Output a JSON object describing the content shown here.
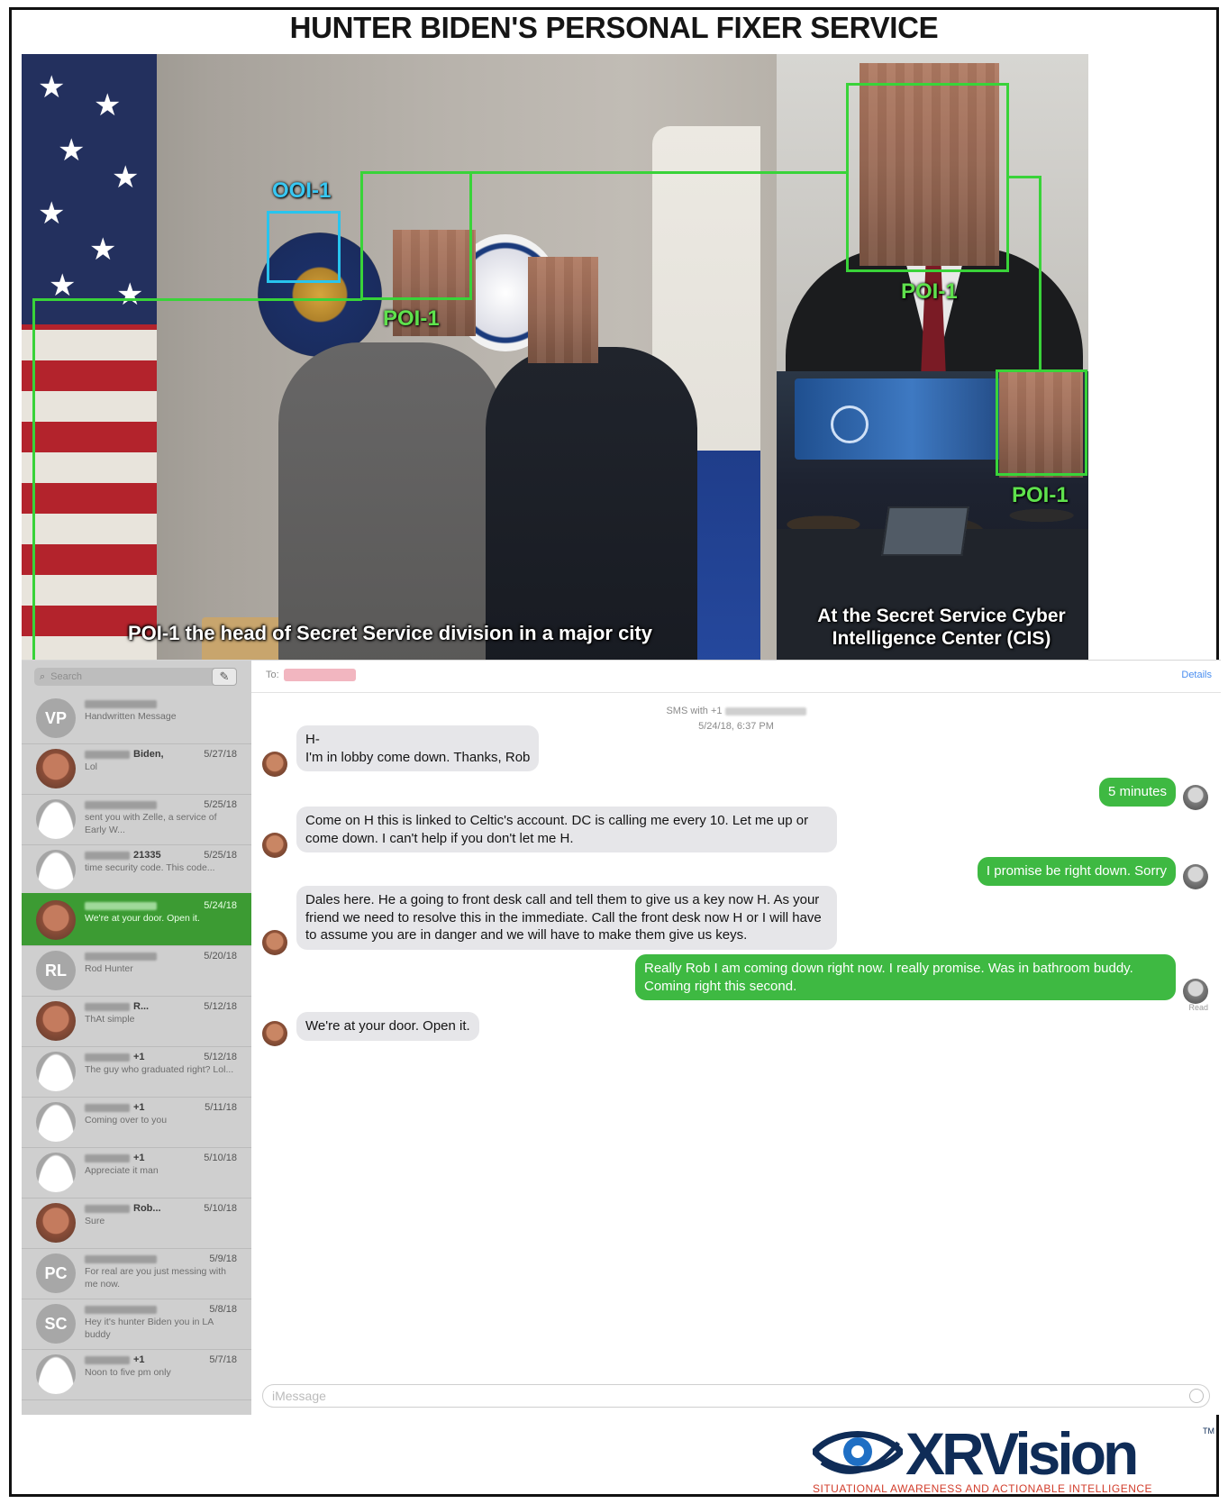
{
  "title": "HUNTER BIDEN'S PERSONAL FIXER SERVICE",
  "photos": {
    "left_caption": "POI-1 the head of Secret Service division in a major city",
    "right_caption_line1": "At the Secret Service Cyber",
    "right_caption_line2": "Intelligence Center (CIS)",
    "labels": {
      "ooi": "OOI-1",
      "poi_left": "POI-1",
      "poi_top_right": "POI-1",
      "poi_bottom_right": "POI-1"
    },
    "colors": {
      "annotation_green": "#39d339",
      "annotation_cyan": "#28c4ee"
    }
  },
  "messages_app": {
    "search_placeholder": "Search",
    "compose_icon": "compose-icon",
    "conversations": [
      {
        "name": "",
        "date": "",
        "preview": "Handwritten Message",
        "avatar": "VP",
        "selected": false
      },
      {
        "name": "Biden,",
        "date": "5/27/18",
        "preview": "Lol",
        "avatar": "photo",
        "selected": false
      },
      {
        "name": "",
        "date": "5/25/18",
        "preview": "sent you with Zelle, a service of Early W...",
        "avatar": "person",
        "selected": false
      },
      {
        "name": "21335",
        "date": "5/25/18",
        "preview": "time security code. This code...",
        "avatar": "person",
        "selected": false
      },
      {
        "name": "",
        "date": "5/24/18",
        "preview": "We're at your door. Open it.",
        "avatar": "photo",
        "selected": true
      },
      {
        "name": "",
        "date": "5/20/18",
        "preview": "Rod Hunter",
        "avatar": "RL",
        "selected": false
      },
      {
        "name": "R...",
        "date": "5/12/18",
        "preview": "ThAt simple",
        "avatar": "photo",
        "selected": false
      },
      {
        "name": "+1",
        "date": "5/12/18",
        "preview": "The guy who graduated right? Lol...",
        "avatar": "person",
        "selected": false
      },
      {
        "name": "+1",
        "date": "5/11/18",
        "preview": "Coming over to you",
        "avatar": "person",
        "selected": false
      },
      {
        "name": "+1",
        "date": "5/10/18",
        "preview": "Appreciate it man",
        "avatar": "person",
        "selected": false
      },
      {
        "name": "Rob...",
        "date": "5/10/18",
        "preview": "Sure",
        "avatar": "photo",
        "selected": false
      },
      {
        "name": "",
        "date": "5/9/18",
        "preview": "For real are you just messing with me now.",
        "avatar": "PC",
        "selected": false
      },
      {
        "name": "",
        "date": "5/8/18",
        "preview": "Hey it's hunter Biden you in LA buddy",
        "avatar": "SC",
        "selected": false
      },
      {
        "name": "+1",
        "date": "5/7/18",
        "preview": "Noon to five pm only",
        "avatar": "person",
        "selected": false
      }
    ],
    "chat": {
      "to_label": "To:",
      "details_label": "Details",
      "sms_header": "SMS with +1",
      "timestamp": "5/24/18, 6:37 PM",
      "messages": [
        {
          "dir": "in",
          "text": "H-\nI'm in lobby come down. Thanks, Rob"
        },
        {
          "dir": "out",
          "text": "5 minutes"
        },
        {
          "dir": "in",
          "text": "Come on H this is linked to Celtic's account. DC is calling me every 10. Let me up or come down. I can't help if you don't let me H."
        },
        {
          "dir": "out",
          "text": "I promise be right down. Sorry"
        },
        {
          "dir": "in",
          "text": "Dales here. He a going to front desk call and tell them to give us a key now H. As your friend we need to resolve this in the immediate. Call the front desk now H or I will have to assume you are in danger and we will have to make them give us keys."
        },
        {
          "dir": "out",
          "text": "Really Rob I am coming down right now. I really promise. Was in bathroom buddy. Coming right this second."
        },
        {
          "dir": "in",
          "text": "We're at your door. Open it."
        }
      ],
      "read_receipt": "Read",
      "input_placeholder": "iMessage"
    }
  },
  "logo": {
    "wordmark": "XRVision",
    "tm": "TM",
    "tagline": "SITUATIONAL AWARENESS AND ACTIONABLE INTELLIGENCE",
    "colors": {
      "navy": "#0f2c57",
      "red": "#d23c2a"
    }
  }
}
